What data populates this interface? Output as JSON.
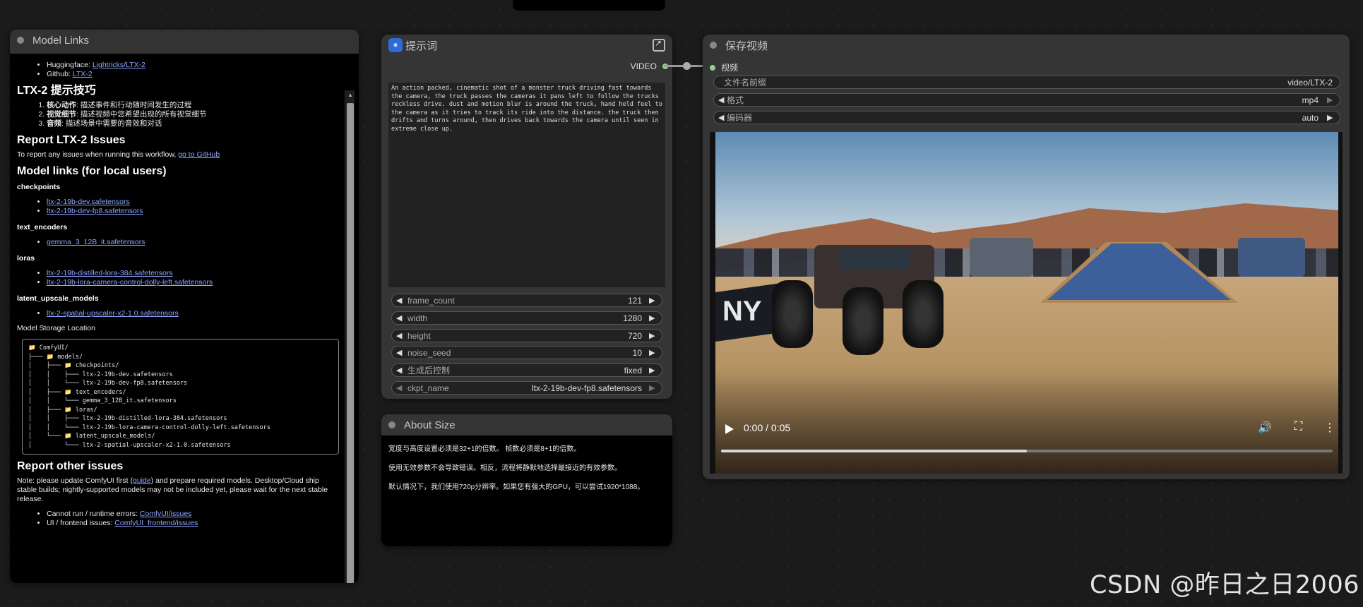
{
  "model_links": {
    "title": "Model Links",
    "huggingface_label": "Huggingface:",
    "huggingface_link": "Lightricks/LTX-2",
    "github_label": "Github:",
    "github_link": "LTX-2",
    "tips_heading": "LTX-2 提示技巧",
    "tips": [
      {
        "bold": "核心动作",
        "text": ": 描述事件和行动随时间发生的过程"
      },
      {
        "bold": "视觉细节",
        "text": ": 描述视频中您希望出现的所有视觉细节"
      },
      {
        "bold": "音频",
        "text": ": 描述场景中需要的音效和对话"
      }
    ],
    "report_heading": "Report LTX-2 Issues",
    "report_text": "To report any issues when running this workflow,",
    "report_link": "go to GitHub",
    "model_links_heading": "Model links (for local users)",
    "checkpoints_heading": "checkpoints",
    "checkpoints": [
      "ltx-2-19b-dev.safetensors",
      "ltx-2-19b-dev-fp8.safetensors"
    ],
    "text_encoders_heading": "text_encoders",
    "text_encoders": [
      "gemma_3_12B_it.safetensors"
    ],
    "loras_heading": "loras",
    "loras": [
      "ltx-2-19b-distilled-lora-384.safetensors",
      "ltx-2-19b-lora-camera-control-dolly-left.safetensors"
    ],
    "upscale_heading": "latent_upscale_models",
    "upscale": [
      "ltx-2-spatial-upscaler-x2-1.0.safetensors"
    ],
    "storage_label": "Model Storage Location",
    "tree": {
      "root": "ComfyUI/",
      "models": "models/",
      "checkpoints": "checkpoints/",
      "ckpt1": "ltx-2-19b-dev.safetensors",
      "ckpt2": "ltx-2-19b-dev-fp8.safetensors",
      "text_encoders": "text_encoders/",
      "te1": "gemma_3_12B_it.safetensors",
      "loras": "loras/",
      "lora1": "ltx-2-19b-distilled-lora-384.safetensors",
      "lora2": "ltx-2-19b-lora-camera-control-dolly-left.safetensors",
      "upscale": "latent_upscale_models/",
      "up1": "ltx-2-spatial-upscaler-x2-1.0.safetensors"
    },
    "other_heading": "Report other issues",
    "note_a": "Note: please update ComfyUI first (",
    "note_link": "guide",
    "note_b": ") and prepare required models. Desktop/Cloud ship stable builds; nightly-supported models may not be included yet, please wait for the next stable release.",
    "runtime_label": "Cannot run / runtime errors:",
    "runtime_link": "ComfyUI/issues",
    "frontend_label": "UI / frontend issues:",
    "frontend_link": "ComfyUI_frontend/issues"
  },
  "prompt_node": {
    "title": "提示词",
    "icon_text": "ၜ",
    "output_label": "VIDEO",
    "prompt_text": "An action packed, cinematic shot of a monster truck driving fast towards the camera, the truck passes the cameras it pans left to follow the trucks reckless drive. dust and motion blur is around the truck, hand held feel to the camera as it tries to track its ride into the distance. the truck then drifts and turns around, then drives back towards the camera until seen in extreme close up.",
    "widgets": [
      {
        "label": "frame_count",
        "value": "121"
      },
      {
        "label": "width",
        "value": "1280"
      },
      {
        "label": "height",
        "value": "720"
      },
      {
        "label": "noise_seed",
        "value": "10"
      },
      {
        "label": "生成后控制",
        "value": "fixed"
      },
      {
        "label": "ckpt_name",
        "value": "ltx-2-19b-dev-fp8.safetensors"
      }
    ]
  },
  "about_size": {
    "title": "About Size",
    "lines": [
      "宽度与高度设置必须是32+1的倍数。 帧数必须是8+1的倍数。",
      "使用无效参数不会导致错误。相反，流程将静默地选择最接近的有效参数。",
      "默认情况下，我们使用720p分辨率。如果您有强大的GPU，可以尝试1920*1088。"
    ]
  },
  "save_video": {
    "title": "保存视频",
    "input_label": "视频",
    "widgets": [
      {
        "label": "文件名前缀",
        "value": "video/LTX-2"
      },
      {
        "label": "格式",
        "value": "mp4"
      },
      {
        "label": "编码器",
        "value": "auto"
      }
    ],
    "video": {
      "time": "0:00 / 0:05",
      "progress": 0.5,
      "banner_text": "NY"
    }
  },
  "watermark": "CSDN @昨日之日2006"
}
